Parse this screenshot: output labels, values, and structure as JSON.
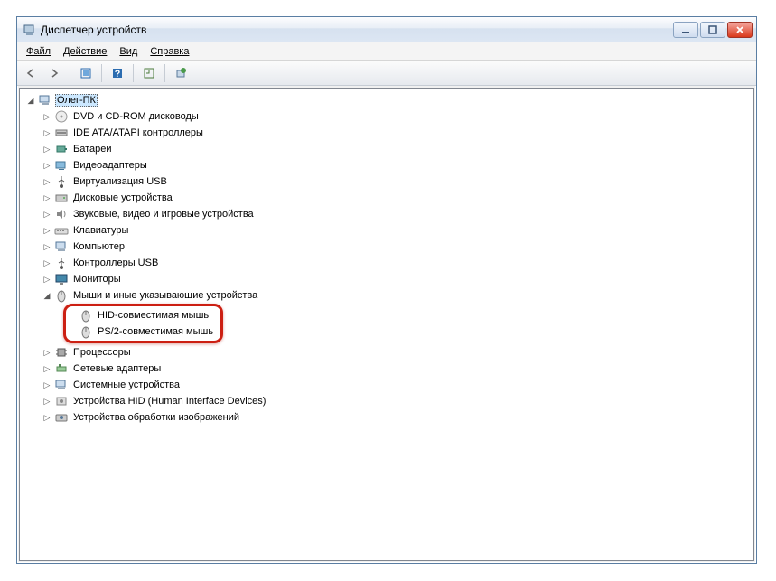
{
  "window": {
    "title": "Диспетчер устройств"
  },
  "menu": {
    "file": "Файл",
    "action": "Действие",
    "view": "Вид",
    "help": "Справка"
  },
  "tree": {
    "root": "Олег-ПК",
    "items": [
      "DVD и CD-ROM дисководы",
      "IDE ATA/ATAPI контроллеры",
      "Батареи",
      "Видеоадаптеры",
      "Виртуализация USB",
      "Дисковые устройства",
      "Звуковые, видео и игровые устройства",
      "Клавиатуры",
      "Компьютер",
      "Контроллеры USB",
      "Мониторы"
    ],
    "mice_label": "Мыши и иные указывающие устройства",
    "mice_children": [
      "HID-совместимая мышь",
      "PS/2-совместимая мышь"
    ],
    "items_after": [
      "Процессоры",
      "Сетевые адаптеры",
      "Системные устройства",
      "Устройства HID (Human Interface Devices)",
      "Устройства обработки изображений"
    ]
  }
}
